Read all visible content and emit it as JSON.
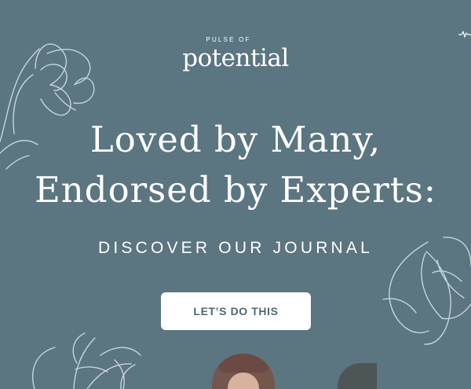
{
  "brand": {
    "top": "PULSE OF",
    "main": "potential"
  },
  "hero": {
    "headline_line1": "Loved by Many,",
    "headline_line2": "Endorsed by Experts:",
    "subheadline": "DISCOVER OUR JOURNAL",
    "cta_label": "LET’S DO THIS"
  },
  "colors": {
    "background": "#5b7581",
    "text": "#ffffff",
    "button_bg": "#ffffff",
    "button_text": "#4f6874"
  },
  "icons": {
    "pulse": "heartbeat-line-icon",
    "left_flower": "line-flower-illustration",
    "right_butterfly": "line-butterfly-illustration",
    "bottom_flower": "line-lily-illustration"
  }
}
